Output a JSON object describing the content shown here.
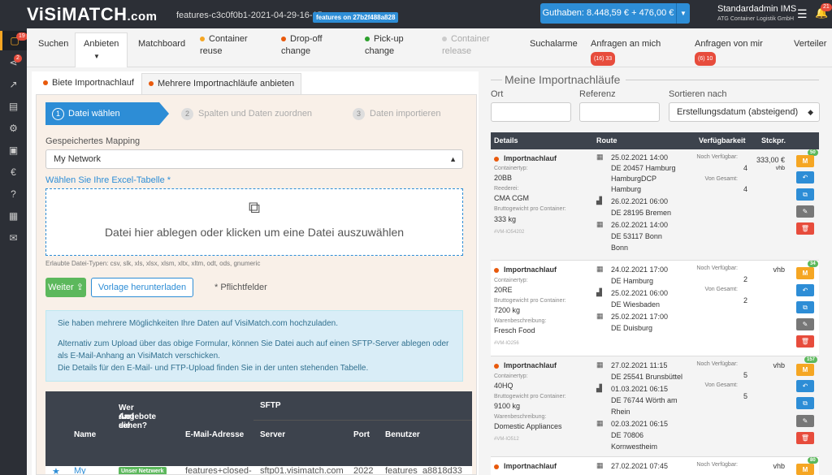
{
  "topbar": {
    "logo_main": "ViSiMATCH",
    "logo_domain": ".com",
    "env_name": "features-c3c0f0b1-2021-04-29-16-15",
    "env_badge": "features on 27b2f488a828",
    "balance": "Guthaben: 8.448,59 € + 476,00 €",
    "user_name": "Standardadmin IMS",
    "company": "ATG Container Logistik GmbH",
    "bell_count": "21"
  },
  "sidebar": {
    "items": [
      {
        "icon": "inbox-icon",
        "badge": "19"
      },
      {
        "icon": "share-icon",
        "badge": "2"
      },
      {
        "icon": "chart-icon",
        "badge": ""
      },
      {
        "icon": "id-card-icon",
        "badge": ""
      },
      {
        "icon": "cogs-icon",
        "badge": ""
      },
      {
        "icon": "money-icon",
        "badge": ""
      },
      {
        "icon": "euro-icon",
        "badge": ""
      },
      {
        "icon": "question-icon",
        "badge": ""
      },
      {
        "icon": "news-icon",
        "badge": ""
      },
      {
        "icon": "mail-icon",
        "badge": ""
      }
    ]
  },
  "nav": {
    "suchen": "Suchen",
    "anbieten": "Anbieten",
    "matchboard": "Matchboard",
    "container_reuse_1": "Container",
    "container_reuse_2": "reuse",
    "dropoff_1": "Drop-off",
    "dropoff_2": "change",
    "pickup_1": "Pick-up",
    "pickup_2": "change",
    "release_1": "Container",
    "release_2": "release",
    "suchalarme": "Suchalarme",
    "anfragen_an_mich": "Anfragen an mich",
    "anfragen_an_mich_badge": "(16) 33",
    "anfragen_von_mir": "Anfragen von mir",
    "anfragen_von_mir_badge": "(6) 10",
    "verteiler": "Verteiler",
    "colors": {
      "orange": "#f5a623",
      "red": "#e8590c",
      "green": "#2ca02c",
      "grey": "#cccccc"
    }
  },
  "left": {
    "tab1": "Biete Importnachlauf",
    "tab2": "Mehrere Importnachläufe anbieten",
    "step1": "Datei wählen",
    "step2": "Spalten und Daten zuordnen",
    "step3": "Daten importieren",
    "mapping_label": "Gespeichertes Mapping",
    "mapping_value": "My Network",
    "excel_label": "Wählen Sie Ihre Excel-Tabelle *",
    "dropzone_text": "Datei hier ablegen oder klicken um eine Datei auszuwählen",
    "file_types": "Erlaubte Datei-Typen: csv, slk, xls, xlsx, xlsm, xltx, xltm, odt, ods, gnumeric",
    "next_button": "Weiter",
    "template_button": "Vorlage herunterladen",
    "required_note": "* Pflichtfelder",
    "info_1": "Sie haben mehrere Möglichkeiten Ihre Daten auf VisiMatch.com hochzuladen.",
    "info_2": "Alternativ zum Upload über das obige Formular, können Sie Datei auch auf einen SFTP-Server ablegen oder als E-Mail-Anhang an VisiMatch verschicken.",
    "info_3": "Die Details für den E-Mail- und FTP-Upload finden Sie in der unten stehenden Tabelle.",
    "table": {
      "col_name": "Name",
      "col_who_1": "Wer darf die",
      "col_who_2": "Angebote",
      "col_who_3": "sehen?",
      "col_email": "E-Mail-Adresse",
      "col_sftp": "SFTP",
      "col_server": "Server",
      "col_port": "Port",
      "col_user": "Benutzer",
      "row_name": "My",
      "row_badge": "Unser Netzwerk",
      "row_email": "features+closed-",
      "row_server": "sftp01.visimatch.com",
      "row_port": "2022",
      "row_user": "features_a8818d33"
    }
  },
  "right": {
    "title": "Meine Importnachläufe",
    "ort_label": "Ort",
    "referenz_label": "Referenz",
    "sort_label": "Sortieren nach",
    "sort_value": "Erstellungsdatum (absteigend)",
    "head_details": "Details",
    "head_route": "Route",
    "head_avail": "Verfügbarkeit",
    "head_price": "Stckpr.",
    "rows": [
      {
        "title": "Importnachlauf",
        "f1l": "Containertyp:",
        "f1v": "20BB",
        "f2l": "Reederei:",
        "f2v": "CMA CGM",
        "f3l": "Bruttogewicht pro Container:",
        "f3v": "333 kg",
        "id": "#VM-IO54202",
        "r1d": "25.02.2021 14:00",
        "r1a": "DE 20457 Hamburg",
        "r1b": "HamburgDCP",
        "r1c": "Hamburg",
        "r2d": "26.02.2021 06:00",
        "r2a": "DE 28195 Bremen",
        "r3d": "26.02.2021 14:00",
        "r3a": "DE 53117 Bonn",
        "r3b": "Bonn",
        "av1": "Noch Verfügbar:",
        "av1v": "4",
        "av2": "Von Gesamt:",
        "av2v": "4",
        "price": "333,00 €",
        "price2": "vhb",
        "count": "50"
      },
      {
        "title": "Importnachlauf",
        "f1l": "Containertyp:",
        "f1v": "20RE",
        "f2l": "Bruttogewicht pro Container:",
        "f2v": "7200 kg",
        "f3l": "Warenbeschreibung:",
        "f3v": "Fresch Food",
        "id": "#VM-IO256",
        "r1d": "24.02.2021 17:00",
        "r1a": "DE Hamburg",
        "r2d": "25.02.2021 06:00",
        "r2a": "DE Wiesbaden",
        "r3d": "25.02.2021 17:00",
        "r3a": "DE Duisburg",
        "av1": "Noch Verfügbar:",
        "av1v": "2",
        "av2": "Von Gesamt:",
        "av2v": "2",
        "price": "vhb",
        "count": "34"
      },
      {
        "title": "Importnachlauf",
        "f1l": "Containertyp:",
        "f1v": "40HQ",
        "f2l": "Bruttogewicht pro Container:",
        "f2v": "9100 kg",
        "f3l": "Warenbeschreibung:",
        "f3v": "Domestic Appliances",
        "id": "#VM-IO512",
        "r1d": "27.02.2021 11:15",
        "r1a": "DE 25541 Brunsbüttel",
        "r2d": "01.03.2021 06:15",
        "r2a": "DE 76744 Wörth am",
        "r2b": "Rhein",
        "r3d": "02.03.2021 06:15",
        "r3a": "DE 70806",
        "r3b": "Kornwestheim",
        "av1": "Noch Verfügbar:",
        "av1v": "5",
        "av2": "Von Gesamt:",
        "av2v": "5",
        "price": "vhb",
        "count": "157"
      },
      {
        "title": "Importnachlauf",
        "r1d": "27.02.2021 07:45",
        "av1": "Noch Verfügbar:",
        "price": "vhb",
        "count": "80"
      }
    ],
    "btn_m": "M"
  }
}
